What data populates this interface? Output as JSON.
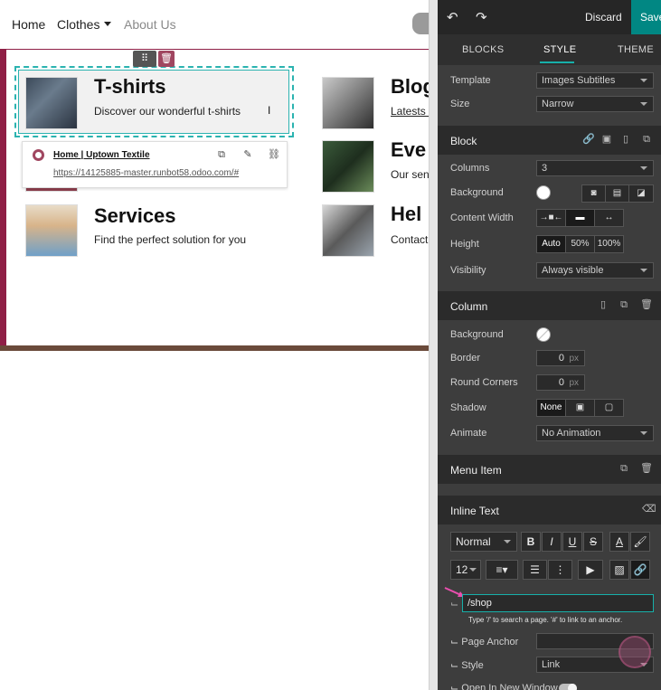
{
  "site": {
    "nav": {
      "home": "Home",
      "clothes": "Clothes",
      "about": "About Us"
    },
    "cards": [
      {
        "title": "T-shirts",
        "subtitle": "Discover our wonderful t-shirts"
      },
      {
        "title": "Services",
        "subtitle": "Find the perfect solution for you"
      },
      {
        "title": "Blog",
        "subtitle": "Latests a"
      },
      {
        "title": "Eve",
        "subtitle": "Our sen"
      },
      {
        "title": "Hel",
        "subtitle": "Contact"
      }
    ],
    "link_popover": {
      "title": "Home | Uptown Textile",
      "url": "https://14125885-master.runbot58.odoo.com/#"
    }
  },
  "editor": {
    "discard": "Discard",
    "save": "Save",
    "tabs": [
      "BLOCKS",
      "STYLE",
      "THEME"
    ],
    "active_tab": "STYLE",
    "template": {
      "label": "Template",
      "value": "Images Subtitles"
    },
    "size": {
      "label": "Size",
      "value": "Narrow"
    },
    "block": {
      "title": "Block",
      "columns": {
        "label": "Columns",
        "value": "3"
      },
      "background": {
        "label": "Background"
      },
      "content_width": {
        "label": "Content Width"
      },
      "height": {
        "label": "Height",
        "options": [
          "Auto",
          "50%",
          "100%"
        ],
        "selected": "Auto"
      },
      "visibility": {
        "label": "Visibility",
        "value": "Always visible"
      }
    },
    "column": {
      "title": "Column",
      "background": {
        "label": "Background"
      },
      "border": {
        "label": "Border",
        "value": "0",
        "unit": "px"
      },
      "round_corners": {
        "label": "Round Corners",
        "value": "0",
        "unit": "px"
      },
      "shadow": {
        "label": "Shadow",
        "none": "None"
      },
      "animate": {
        "label": "Animate",
        "value": "No Animation"
      }
    },
    "menu_item": {
      "title": "Menu Item"
    },
    "inline_text": {
      "title": "Inline Text",
      "style_select": "Normal",
      "font_size": "12",
      "bold": "B",
      "italic": "I",
      "underline": "U",
      "strike": "S",
      "font_color": "A",
      "link_value": "/shop",
      "link_hint": "Type '/' to search a page. '#' to link to an anchor.",
      "page_anchor": {
        "label": "Page Anchor",
        "value": ""
      },
      "style": {
        "label": "Style",
        "value": "Link"
      },
      "new_window": {
        "label": "Open In New Window"
      }
    }
  },
  "colors": {
    "accent": "#018783",
    "selection": "#2bb3b0",
    "brand": "#8f1f46"
  }
}
